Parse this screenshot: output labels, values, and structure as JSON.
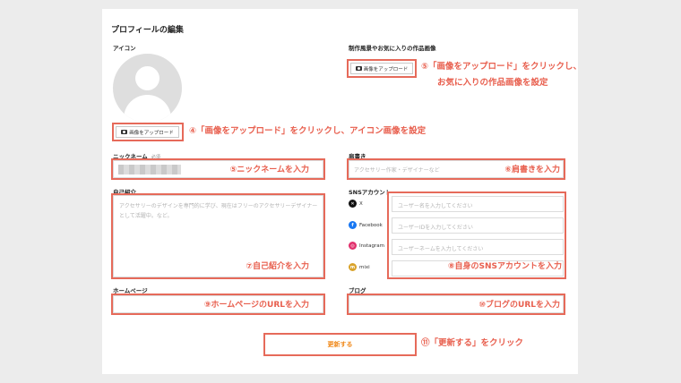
{
  "page": {
    "title": "プロフィールの編集"
  },
  "icon_section": {
    "label": "アイコン",
    "upload_label": "画像をアップロード"
  },
  "works_section": {
    "label": "制作風景やお気に入りの作品画像",
    "upload_label": "画像をアップロード"
  },
  "nickname": {
    "label": "ニックネーム",
    "required": "必須"
  },
  "title_field": {
    "label": "肩書き",
    "placeholder": "アクセサリー作家・デザイナーなど"
  },
  "bio": {
    "label": "自己紹介",
    "placeholder": "アクセサリーのデザインを専門的に学び、現在はフリーのアクセサリーデザイナーとして活躍中。など。"
  },
  "sns": {
    "label": "SNSアカウント",
    "items": [
      {
        "name": "X",
        "placeholder": "ユーザー名を入力してください",
        "color": "#111111"
      },
      {
        "name": "Facebook",
        "placeholder": "ユーザーIDを入力してください",
        "color": "#1877f2"
      },
      {
        "name": "Instagram",
        "placeholder": "ユーザーネームを入力してください",
        "color": "#e1306c"
      },
      {
        "name": "mixi",
        "placeholder": "",
        "color": "#d9a32b"
      }
    ]
  },
  "homepage": {
    "label": "ホームページ"
  },
  "blog": {
    "label": "ブログ"
  },
  "submit": {
    "label": "更新する"
  },
  "annotations": {
    "works_upload_line1": "⑤「画像をアップロード」をクリックし、",
    "works_upload_line2": "お気に入りの作品画像を設定",
    "icon_upload": "④「画像をアップロード」をクリックし、アイコン画像を設定",
    "nickname": "⑤ニックネームを入力",
    "title": "⑥肩書きを入力",
    "bio": "⑦自己紹介を入力",
    "sns": "⑧自身のSNSアカウントを入力",
    "homepage": "⑨ホームページのURLを入力",
    "blog": "⑩ブログのURLを入力",
    "submit": "⑪「更新する」をクリック"
  },
  "colors": {
    "accent": "#e85f4e",
    "submit_text": "#f08a1c"
  }
}
